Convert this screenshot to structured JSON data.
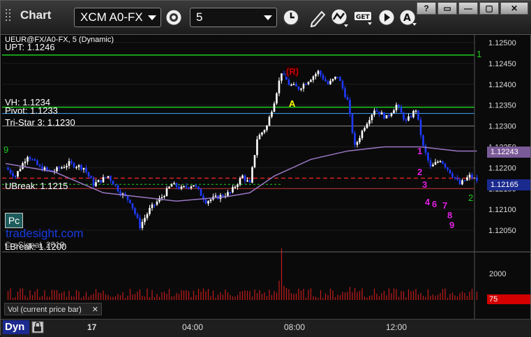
{
  "app": {
    "title": "Chart",
    "dyn_label": "Dyn"
  },
  "toolbar": {
    "symbol": "XCM A0-FX",
    "interval": "5"
  },
  "window_buttons": [
    "?",
    "▭",
    "—",
    "▢",
    "✕"
  ],
  "chart": {
    "header": "UEUR@FX/A0-FX, 5 (Dynamic)",
    "levels": {
      "upt": "UPT: 1.1246",
      "vh": "VH: 1.1234",
      "pivot": "Pivot: 1.1233",
      "tristar": "Tri-Star 3: 1.1230",
      "ubreak": "UBreak: 1.1215",
      "lbreak": "LBreak: 1.1200"
    },
    "price_axis": [
      "1.12500",
      "1.12450",
      "1.12400",
      "1.12350",
      "1.12300",
      "1.12250",
      "1.12200",
      "1.12150",
      "1.12100",
      "1.12050"
    ],
    "last_price": "1.12165",
    "ma_value": "1.12243",
    "volume_axis": "2000",
    "volume_last": "75",
    "markers": {
      "r": "(R)",
      "a": "A"
    },
    "brand": "tradesight.com",
    "copyright": "© eSignal, 2019",
    "pc": "Pc",
    "volume_panel_label": "Vol (current price bar)",
    "time_axis": [
      "17",
      "04:00",
      "08:00",
      "12:00"
    ],
    "td_counts_magenta": [
      "1",
      "2",
      "3",
      "4",
      "6",
      "7",
      "8",
      "9"
    ],
    "td_counts_green": [
      "9",
      "1",
      "2"
    ],
    "colors": {
      "up": "#ffffff",
      "down": "#1f3bff",
      "ma": "#9a78c4",
      "green_line": "#1fcc1f",
      "pivot_line": "#3fa5ff",
      "red_dash": "#e02020",
      "volume": "#c41a1a",
      "td_magenta": "#e020e0"
    }
  },
  "chart_data": {
    "type": "candlestick",
    "symbol": "XCM A0-FX",
    "interval": "5",
    "yrange": [
      1.1201,
      1.1252
    ],
    "x_ticks": [
      "17",
      "04:00",
      "08:00",
      "12:00"
    ],
    "reference_lines": [
      {
        "label": "UPT",
        "value": 1.1246
      },
      {
        "label": "VH",
        "value": 1.1234
      },
      {
        "label": "Pivot",
        "value": 1.1233
      },
      {
        "label": "Tri-Star 3",
        "value": 1.123
      },
      {
        "label": "UBreak",
        "value": 1.1215
      },
      {
        "label": "LBreak",
        "value": 1.12
      }
    ],
    "last": 1.12165,
    "ma_last": 1.12243,
    "path": [
      [
        0,
        1.122
      ],
      [
        4,
        1.1218
      ],
      [
        9,
        1.1223
      ],
      [
        14,
        1.122
      ],
      [
        19,
        1.1219
      ],
      [
        26,
        1.1221
      ],
      [
        32,
        1.122
      ],
      [
        36,
        1.1216
      ],
      [
        42,
        1.1218
      ],
      [
        47,
        1.1214
      ],
      [
        51,
        1.1212
      ],
      [
        55,
        1.1206
      ],
      [
        59,
        1.121
      ],
      [
        64,
        1.1213
      ],
      [
        68,
        1.1216
      ],
      [
        72,
        1.1215
      ],
      [
        77,
        1.1216
      ],
      [
        82,
        1.1212
      ],
      [
        87,
        1.1213
      ],
      [
        92,
        1.1214
      ],
      [
        97,
        1.1218
      ],
      [
        100,
        1.1216
      ],
      [
        103,
        1.1227
      ],
      [
        107,
        1.123
      ],
      [
        110,
        1.1236
      ],
      [
        113,
        1.1243
      ],
      [
        116,
        1.124
      ],
      [
        120,
        1.1239
      ],
      [
        124,
        1.1241
      ],
      [
        128,
        1.1243
      ],
      [
        132,
        1.124
      ],
      [
        136,
        1.1242
      ],
      [
        140,
        1.1236
      ],
      [
        143,
        1.1225
      ],
      [
        147,
        1.123
      ],
      [
        151,
        1.1234
      ],
      [
        156,
        1.1232
      ],
      [
        160,
        1.1235
      ],
      [
        164,
        1.1231
      ],
      [
        168,
        1.1234
      ],
      [
        171,
        1.1225
      ],
      [
        174,
        1.122
      ],
      [
        178,
        1.1222
      ],
      [
        182,
        1.1219
      ],
      [
        186,
        1.1216
      ],
      [
        190,
        1.1218
      ],
      [
        193,
        1.1217
      ]
    ],
    "ma_path": [
      [
        0,
        1.1221
      ],
      [
        20,
        1.1219
      ],
      [
        40,
        1.1214
      ],
      [
        55,
        1.1213
      ],
      [
        70,
        1.1212
      ],
      [
        90,
        1.1213
      ],
      [
        100,
        1.1214
      ],
      [
        110,
        1.1218
      ],
      [
        125,
        1.1222
      ],
      [
        140,
        1.1224
      ],
      [
        155,
        1.1225
      ],
      [
        170,
        1.1225
      ],
      [
        185,
        1.1224
      ],
      [
        193,
        1.1224
      ]
    ]
  }
}
